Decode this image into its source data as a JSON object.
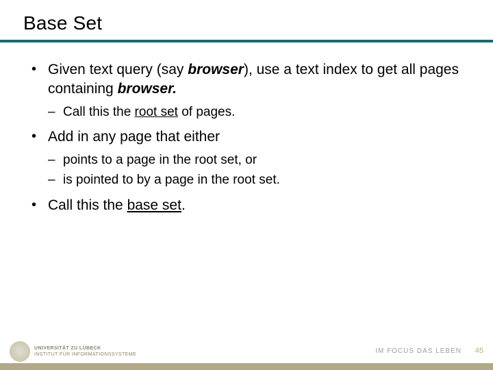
{
  "title": "Base Set",
  "bullets": {
    "b1_pre": "Given text query (say ",
    "b1_bold1": "browser",
    "b1_mid": "), use a text index to get all pages containing ",
    "b1_bold2": "browser.",
    "b1_sub1_pre": "Call this the ",
    "b1_sub1_u": "root set",
    "b1_sub1_post": " of pages.",
    "b2": "Add in any page that either",
    "b2_sub1": "points to a page in the root set, or",
    "b2_sub2": "is pointed to by a page in the root set.",
    "b3_pre": "Call this the ",
    "b3_u": "base set",
    "b3_post": "."
  },
  "footer": {
    "uni_top": "UNIVERSITÄT ZU LÜBECK",
    "uni_sub": "INSTITUT FÜR INFORMATIONSSYSTEME",
    "motto": "IM FOCUS DAS LEBEN",
    "page": "45"
  }
}
